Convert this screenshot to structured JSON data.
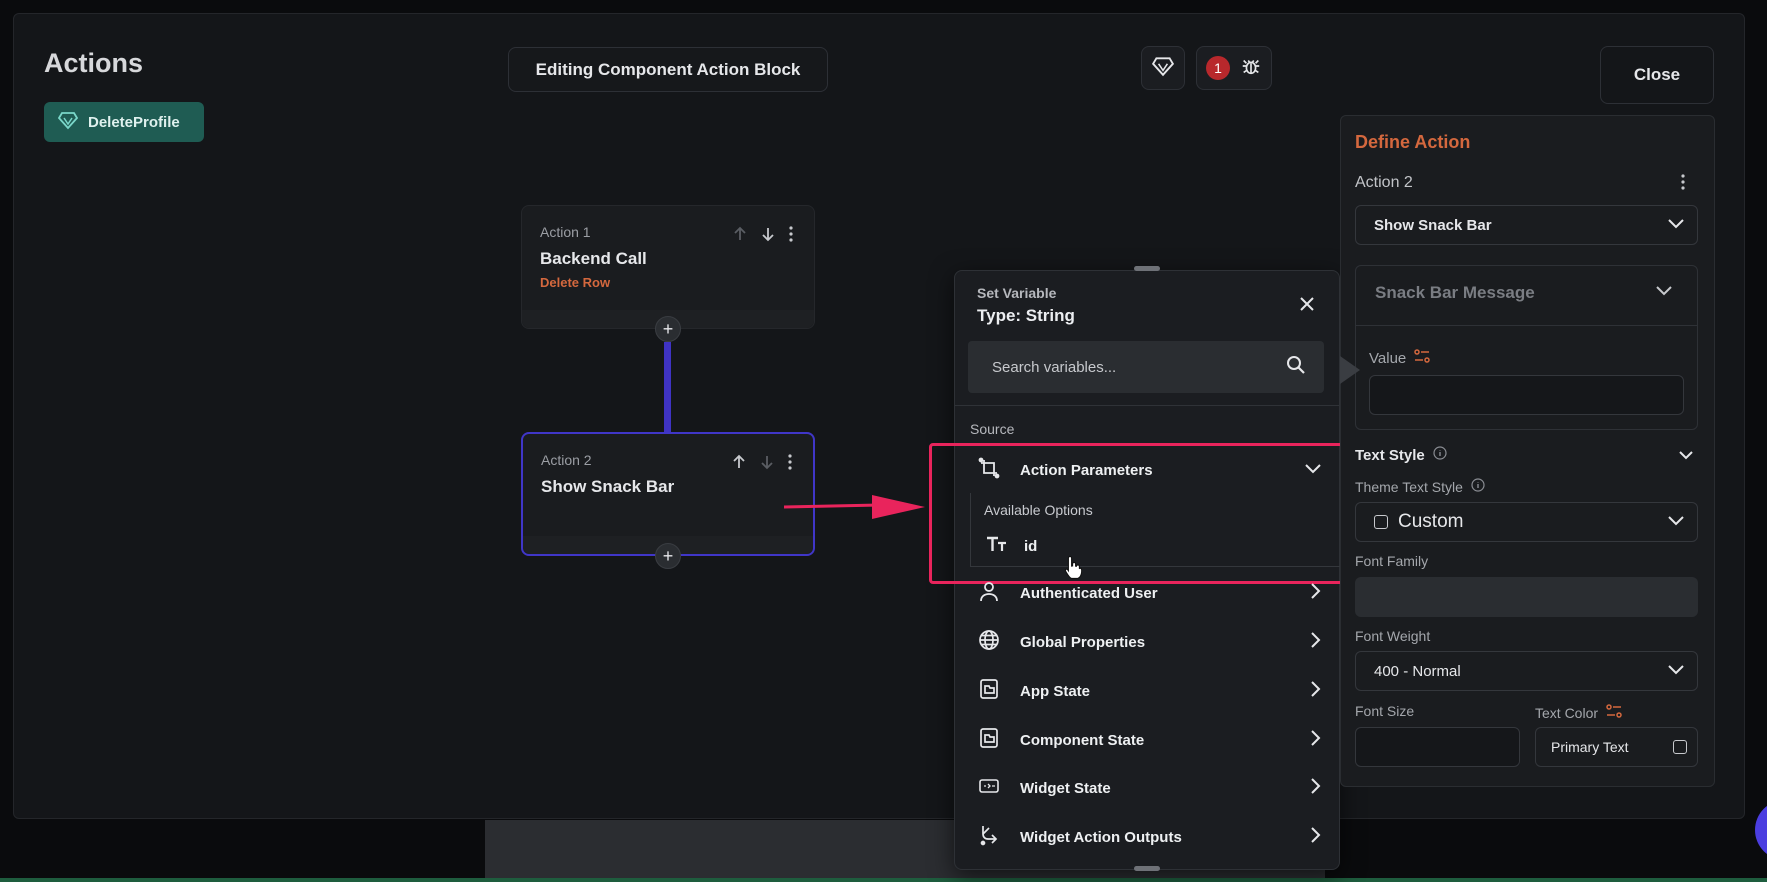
{
  "header": {
    "title": "Actions",
    "component_name": "DeleteProfile",
    "editing_label": "Editing Component Action Block",
    "debug_count": "1",
    "close_label": "Close"
  },
  "actions": [
    {
      "number": "Action 1",
      "name": "Backend Call",
      "subtitle": "Delete Row"
    },
    {
      "number": "Action 2",
      "name": "Show Snack Bar",
      "subtitle": ""
    }
  ],
  "set_variable": {
    "kicker": "Set Variable",
    "type_label": "Type: String",
    "search_placeholder": "Search variables...",
    "source_label": "Source",
    "sources": [
      {
        "label": "Action Parameters",
        "icon": "action-parameters-icon",
        "expanded": true
      },
      {
        "label": "Authenticated User",
        "icon": "user-icon"
      },
      {
        "label": "Global Properties",
        "icon": "globe-icon"
      },
      {
        "label": "App State",
        "icon": "app-state-icon"
      },
      {
        "label": "Component State",
        "icon": "component-state-icon"
      },
      {
        "label": "Widget State",
        "icon": "widget-state-icon"
      },
      {
        "label": "Widget Action Outputs",
        "icon": "widget-action-outputs-icon"
      }
    ],
    "available_options_label": "Available Options",
    "options": [
      {
        "label": "id",
        "icon": "text-type-icon"
      }
    ]
  },
  "define_action": {
    "title": "Define Action",
    "action_label": "Action 2",
    "action_type": "Show Snack Bar",
    "snack_bar_message_label": "Snack Bar Message",
    "value_label": "Value",
    "text_style_label": "Text Style",
    "theme_text_style_label": "Theme Text Style",
    "theme_text_style_value": "Custom",
    "font_family_label": "Font Family",
    "font_weight_label": "Font Weight",
    "font_weight_value": "400 - Normal",
    "font_size_label": "Font Size",
    "text_color_label": "Text Color",
    "text_color_value": "Primary Text"
  },
  "colors": {
    "accent_orange": "#d4683e",
    "selection_purple": "#4036c8",
    "highlight_pink": "#e9245c",
    "chip_teal": "#1f5c53"
  }
}
